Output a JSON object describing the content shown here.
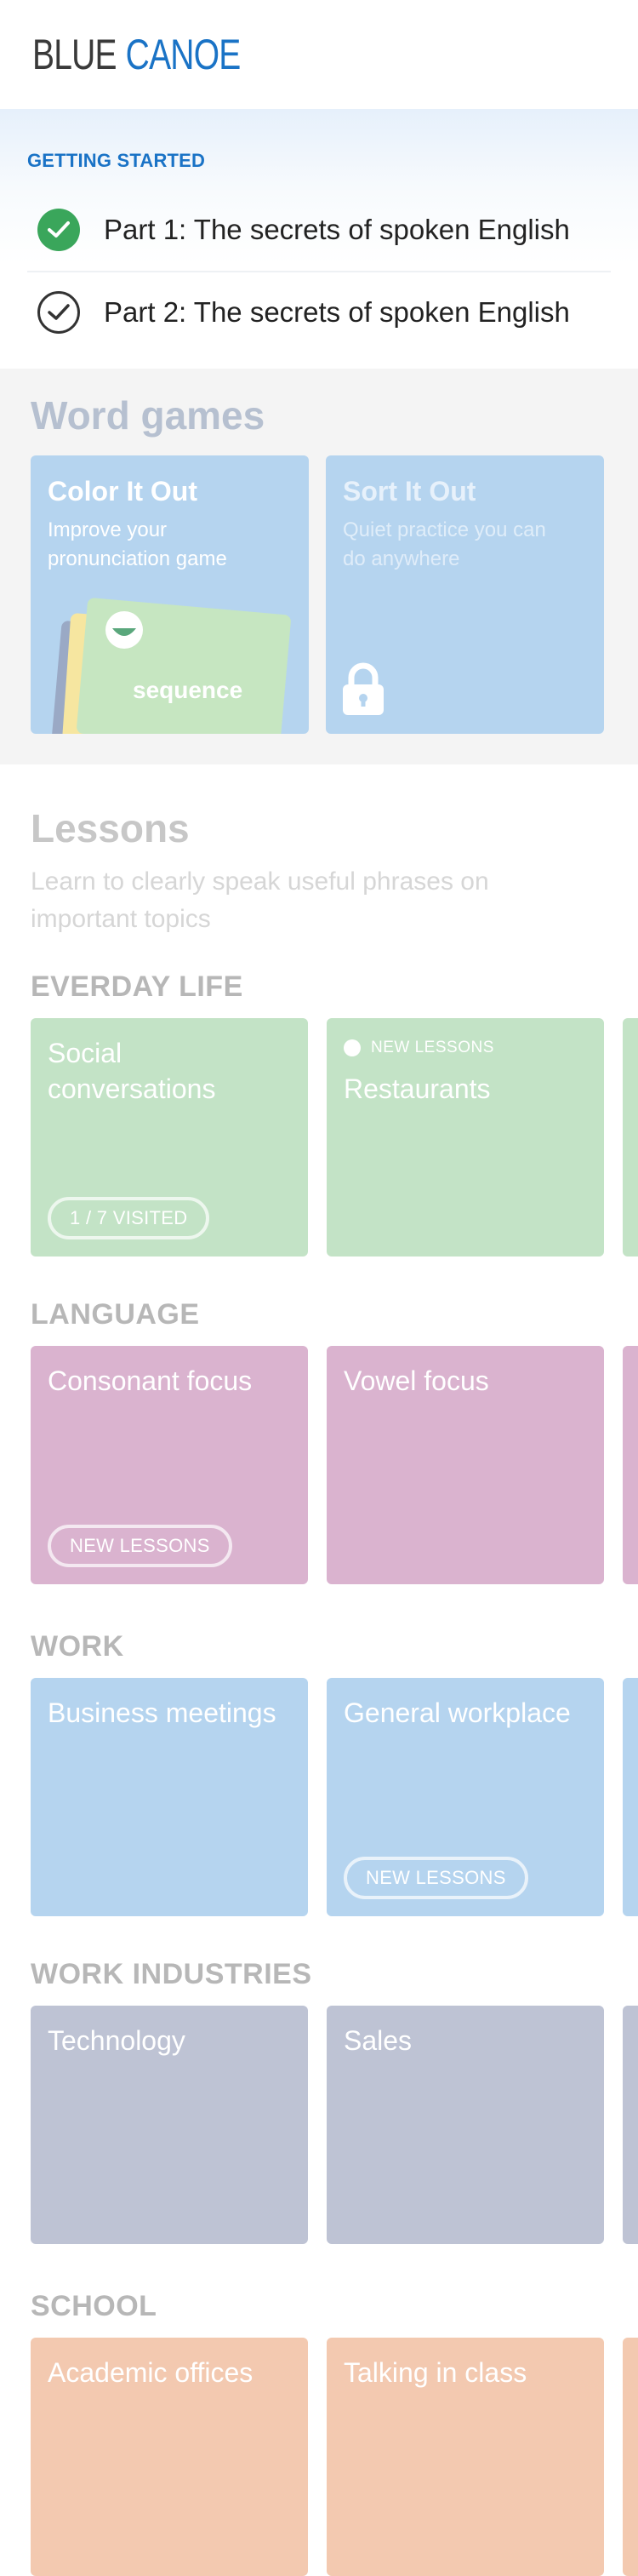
{
  "header": {
    "logo_part1": "BLUE",
    "logo_part2": "CANOE"
  },
  "getting_started": {
    "title": "GETTING STARTED",
    "items": [
      {
        "label": "Part 1: The secrets of spoken English",
        "status": "completed"
      },
      {
        "label": "Part 2: The secrets of spoken English",
        "status": "not-completed"
      }
    ]
  },
  "word_games": {
    "title": "Word games",
    "cards": [
      {
        "title": "Color It Out",
        "subtitle": "Improve your pronunciation game",
        "illustration_text": "sequence",
        "locked": false
      },
      {
        "title": "Sort It Out",
        "subtitle": "Quiet practice you can do anywhere",
        "locked": true
      }
    ]
  },
  "lessons": {
    "title": "Lessons",
    "subtitle": "Learn to clearly speak useful phrases on important topics",
    "categories": [
      {
        "label": "EVERDAY LIFE",
        "color": "#c3e3c6",
        "tiles": [
          {
            "name": "Social conversations",
            "tag": "",
            "pill": "1 / 7 VISITED"
          },
          {
            "name": "Restaurants",
            "tag": "NEW LESSONS",
            "pill": ""
          }
        ]
      },
      {
        "label": "LANGUAGE",
        "color": "#dab3cf",
        "tiles": [
          {
            "name": "Consonant focus",
            "tag": "",
            "pill": "NEW LESSONS"
          },
          {
            "name": "Vowel focus",
            "tag": "",
            "pill": ""
          }
        ]
      },
      {
        "label": "WORK",
        "color": "#b5d4ef",
        "tiles": [
          {
            "name": "Business meetings",
            "tag": "",
            "pill": ""
          },
          {
            "name": "General workplace",
            "tag": "",
            "pill": "NEW LESSONS"
          }
        ]
      },
      {
        "label": "WORK INDUSTRIES",
        "color": "#bec3d4",
        "tiles": [
          {
            "name": "Technology",
            "tag": "",
            "pill": ""
          },
          {
            "name": "Sales",
            "tag": "",
            "pill": ""
          }
        ]
      },
      {
        "label": "SCHOOL",
        "color": "#f3c9b0",
        "tiles": [
          {
            "name": "Academic offices",
            "tag": "",
            "pill": ""
          },
          {
            "name": "Talking in class",
            "tag": "",
            "pill": ""
          }
        ]
      }
    ]
  },
  "icons": {
    "completed_check": "check-circle-filled-icon",
    "pending_check": "check-circle-outline-icon",
    "lock": "lock-icon",
    "new_dot": "dot-icon"
  },
  "colors": {
    "brand_blue": "#1a73c6",
    "success_green": "#3aa65b"
  }
}
